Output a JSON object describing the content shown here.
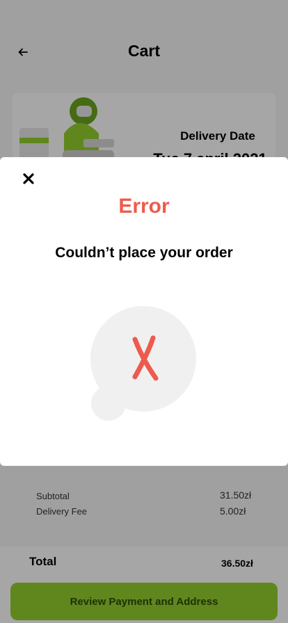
{
  "header": {
    "title": "Cart",
    "back_icon": "arrow-left-icon"
  },
  "delivery": {
    "label": "Delivery Date",
    "date": "Tue 7 april 2021"
  },
  "summary": {
    "subtotal_label": "Subtotal",
    "subtotal_value": "31.50zł",
    "delivery_fee_label": "Delivery Fee",
    "delivery_fee_value": "5.00zł"
  },
  "footer": {
    "total_label": "Total",
    "total_value": "36.50zł",
    "review_button_label": "Review Payment and Address"
  },
  "modal": {
    "close_icon": "close-icon",
    "title": "Error",
    "message": "Couldn’t place your order",
    "graphic_icon": "error-x-icon"
  },
  "colors": {
    "accent_green": "#94cf2e",
    "error_red": "#ee5a4e"
  }
}
